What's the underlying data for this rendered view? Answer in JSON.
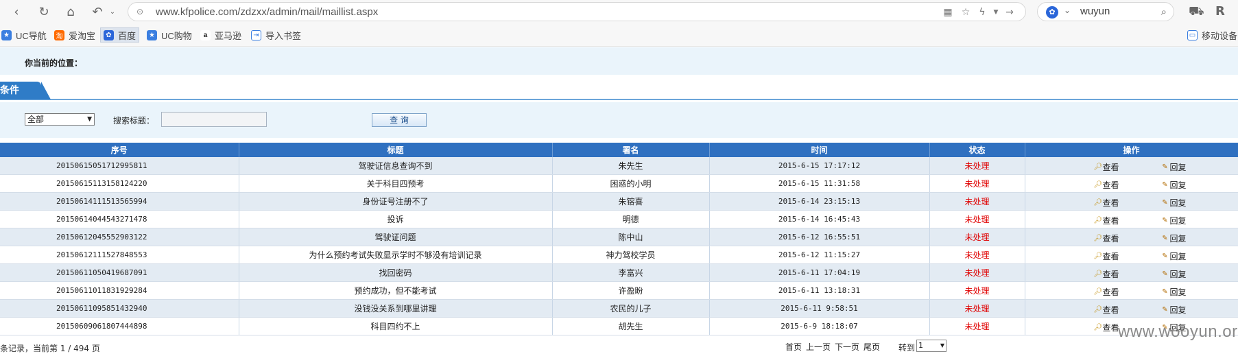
{
  "browser": {
    "url": "www.kfpolice.com/zdzxx/admin/mail/maillist.aspx",
    "search_query": "wuyun",
    "bookmarks": [
      "UC导航",
      "爱淘宝",
      "百度",
      "UC购物",
      "亚马逊",
      "导入书签"
    ],
    "mobile_device": "移动设备"
  },
  "page": {
    "location_label": "你当前的位置：",
    "tab_label": "条件",
    "filter": {
      "select_value": "全部",
      "search_label": "搜索标题：",
      "search_value": "",
      "query_button": "查 询"
    },
    "table": {
      "headers": [
        "序号",
        "标题",
        "署名",
        "时间",
        "状态",
        "操作"
      ],
      "rows": [
        {
          "id": "20150615051712995811",
          "title": "驾驶证信息查询不到",
          "author": "朱先生",
          "time": "2015-6-15 17:17:12",
          "status": "未处理",
          "view": "查看",
          "reply": "回复"
        },
        {
          "id": "20150615113158124220",
          "title": "关于科目四预考",
          "author": "困惑的小明",
          "time": "2015-6-15 11:31:58",
          "status": "未处理",
          "view": "查看",
          "reply": "回复"
        },
        {
          "id": "20150614111513565994",
          "title": "身份证号注册不了",
          "author": "朱镕喜",
          "time": "2015-6-14 23:15:13",
          "status": "未处理",
          "view": "查看",
          "reply": "回复"
        },
        {
          "id": "20150614044543271478",
          "title": "投诉",
          "author": "明德",
          "time": "2015-6-14 16:45:43",
          "status": "未处理",
          "view": "查看",
          "reply": "回复"
        },
        {
          "id": "20150612045552903122",
          "title": "驾驶证问题",
          "author": "陈中山",
          "time": "2015-6-12 16:55:51",
          "status": "未处理",
          "view": "查看",
          "reply": "回复"
        },
        {
          "id": "20150612111527848553",
          "title": "为什么预约考试失败显示学时不够没有培训记录",
          "author": "神力驾校学员",
          "time": "2015-6-12 11:15:27",
          "status": "未处理",
          "view": "查看",
          "reply": "回复"
        },
        {
          "id": "20150611050419687091",
          "title": "找回密码",
          "author": "李富兴",
          "time": "2015-6-11 17:04:19",
          "status": "未处理",
          "view": "查看",
          "reply": "回复"
        },
        {
          "id": "20150611011831929284",
          "title": "预约成功，但不能考试",
          "author": "许盈盼",
          "time": "2015-6-11 13:18:31",
          "status": "未处理",
          "view": "查看",
          "reply": "回复"
        },
        {
          "id": "20150611095851432940",
          "title": "没钱没关系到哪里讲理",
          "author": "农民的儿子",
          "time": "2015-6-11 9:58:51",
          "status": "未处理",
          "view": "查看",
          "reply": "回复"
        },
        {
          "id": "20150609061807444898",
          "title": "科目四约不上",
          "author": "胡先生",
          "time": "2015-6-9 18:18:07",
          "status": "未处理",
          "view": "查看",
          "reply": "回复"
        }
      ]
    },
    "footer": {
      "record_info": "条记录，当前第 1 / 494 页",
      "first": "首页",
      "prev": "上一页",
      "next": "下一页",
      "last": "尾页",
      "goto_label": "转到",
      "goto_value": "1"
    }
  },
  "watermark": "www.wooyun.org",
  "colors": {
    "header_blue": "#2f70c0",
    "status_red": "#e00000",
    "panel_bg": "#eaf4fb"
  }
}
